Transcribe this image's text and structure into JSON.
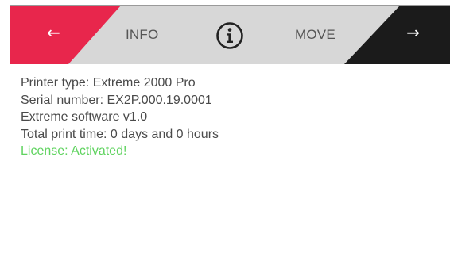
{
  "header": {
    "back_arrow": "←",
    "next_arrow": "→",
    "tab_info": "INFO",
    "tab_move": "MOVE",
    "center_icon": "info-circle-icon"
  },
  "colors": {
    "back_accent": "#e8264c",
    "next_accent": "#1b1b1b",
    "header_bg": "#d7d7d7",
    "license_text": "#5fd35f"
  },
  "info": {
    "printer_type": "Printer type: Extreme 2000 Pro",
    "serial_number": "Serial number: EX2P.000.19.0001",
    "software": "Extreme software v1.0",
    "print_time": "Total print time: 0 days and 0 hours",
    "license": "License: Activated!"
  }
}
